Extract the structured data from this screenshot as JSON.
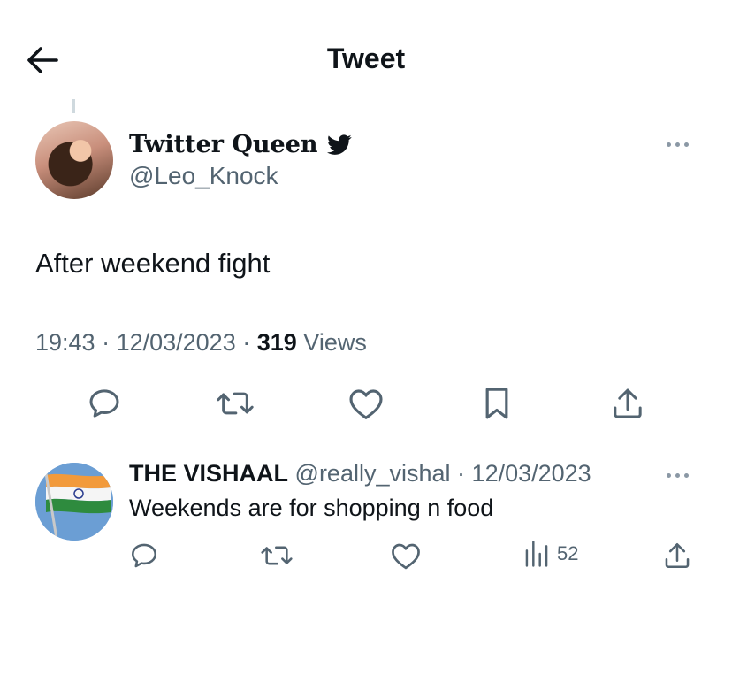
{
  "header": {
    "title": "Tweet"
  },
  "tweet": {
    "author_name": "Twitter Queen",
    "author_handle": "@Leo_Knock",
    "text": "After weekend fight",
    "time": "19:43",
    "date": "12/03/2023",
    "views_count": "319",
    "views_label": "Views",
    "meta_separator": " · "
  },
  "reply": {
    "author_name": "THE VISHAAL",
    "author_handle": "@really_vishal",
    "separator": "·",
    "date": "12/03/2023",
    "text": "Weekends are for shopping n food",
    "views": "52"
  },
  "icons": {
    "back": "arrow-left-icon",
    "verified": "twitter-bird-icon",
    "more": "more-horizontal-icon",
    "reply": "reply-icon",
    "retweet": "retweet-icon",
    "like": "heart-icon",
    "bookmark": "bookmark-icon",
    "share": "share-icon",
    "views": "bar-chart-icon"
  },
  "colors": {
    "text": "#0f1419",
    "secondary": "#536471",
    "divider": "#cfd9de"
  }
}
